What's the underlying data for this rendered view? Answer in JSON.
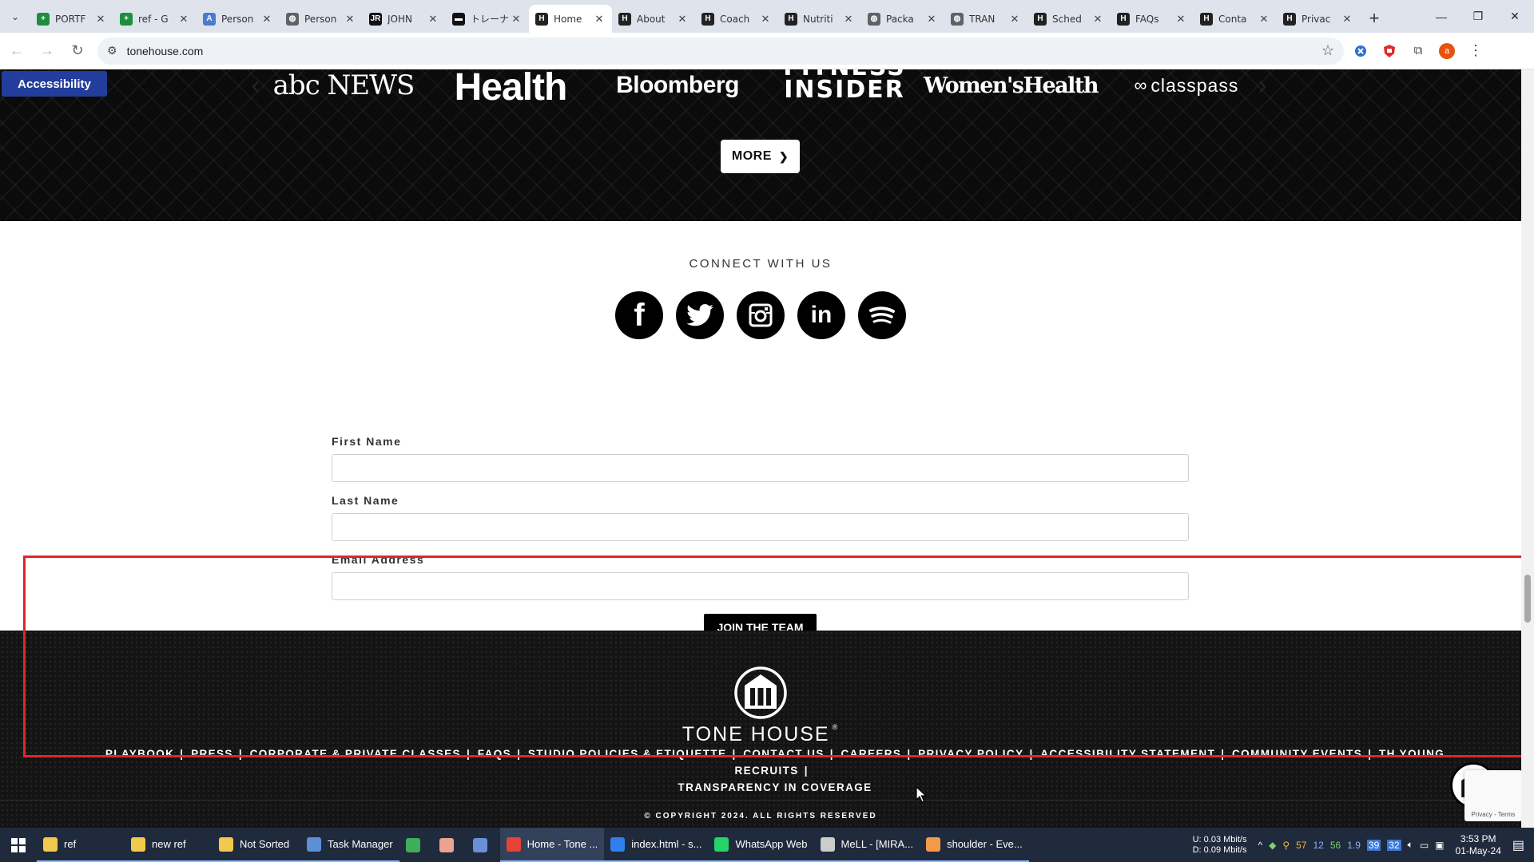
{
  "browser": {
    "tabs": [
      {
        "title": "PORTF",
        "favicon_color": "#1e8e3e",
        "favicon_glyph": "+"
      },
      {
        "title": "ref - G",
        "favicon_color": "#1e8e3e",
        "favicon_glyph": "+"
      },
      {
        "title": "Person",
        "favicon_color": "#4a7bd0",
        "favicon_glyph": "A"
      },
      {
        "title": "Person",
        "favicon_color": "#5f6368",
        "favicon_glyph": "◍"
      },
      {
        "title": "JOHN",
        "favicon_color": "#111111",
        "favicon_glyph": "JR"
      },
      {
        "title": "トレーナ",
        "favicon_color": "#111111",
        "favicon_glyph": "▬"
      },
      {
        "title": "Home",
        "favicon_color": "#222222",
        "favicon_glyph": "H",
        "active": true
      },
      {
        "title": "About",
        "favicon_color": "#222222",
        "favicon_glyph": "H"
      },
      {
        "title": "Coach",
        "favicon_color": "#222222",
        "favicon_glyph": "H"
      },
      {
        "title": "Nutriti",
        "favicon_color": "#222222",
        "favicon_glyph": "H"
      },
      {
        "title": "Packa",
        "favicon_color": "#5f6368",
        "favicon_glyph": "◍"
      },
      {
        "title": "TRAN",
        "favicon_color": "#5f6368",
        "favicon_glyph": "◍"
      },
      {
        "title": "Sched",
        "favicon_color": "#222222",
        "favicon_glyph": "H"
      },
      {
        "title": "FAQs",
        "favicon_color": "#222222",
        "favicon_glyph": "H"
      },
      {
        "title": "Conta",
        "favicon_color": "#222222",
        "favicon_glyph": "H"
      },
      {
        "title": "Privac",
        "favicon_color": "#222222",
        "favicon_glyph": "H"
      }
    ],
    "url": "tonehouse.com",
    "profile_initial": "a"
  },
  "page": {
    "accessibility_label": "Accessibility",
    "press_logos": {
      "abc": "abc NEWS",
      "health": "Health",
      "bloomberg": "Bloomberg",
      "fitness_insider_line1": "FITNESS",
      "fitness_insider_line2": "INSIDER",
      "womens_health": "Women'sHealth",
      "classpass": "classpass"
    },
    "more_label": "MORE",
    "connect": {
      "title": "CONNECT WITH US",
      "social": [
        {
          "name": "facebook",
          "glyph": "f"
        },
        {
          "name": "twitter",
          "glyph": "t"
        },
        {
          "name": "instagram",
          "glyph": "◎"
        },
        {
          "name": "linkedin",
          "glyph": "in"
        },
        {
          "name": "spotify",
          "glyph": "≋"
        }
      ]
    },
    "form": {
      "first_name_label": "First Name",
      "first_name_value": "",
      "last_name_label": "Last Name",
      "last_name_value": "",
      "email_label": "Email Address",
      "email_value": "",
      "submit_label": "JOIN THE TEAM"
    },
    "footer": {
      "brand": "TONE HOUSE",
      "brand_mark": "®",
      "links": [
        "PLAYBOOK",
        "PRESS",
        "CORPORATE & PRIVATE CLASSES",
        "FAQS",
        "STUDIO POLICIES & ETIQUETTE",
        "CONTACT US",
        "CAREERS",
        "PRIVACY POLICY",
        "ACCESSIBILITY STATEMENT",
        "COMMUNITY EVENTS",
        "TH YOUNG RECRUITS",
        "TRANSPARENCY IN COVERAGE"
      ],
      "separator": "|",
      "copyright": "© COPYRIGHT 2024. ALL RIGHTS RESERVED"
    },
    "recaptcha_text": "Privacy - Terms"
  },
  "taskbar": {
    "items": [
      {
        "label": "ref",
        "icon_color": "#f2c94c",
        "state": "running"
      },
      {
        "label": "new ref",
        "icon_color": "#f2c94c",
        "state": "running"
      },
      {
        "label": "Not Sorted",
        "icon_color": "#f2c94c",
        "state": "running"
      },
      {
        "label": "Task Manager",
        "icon_color": "#5c8fd6",
        "state": "running"
      },
      {
        "label": "",
        "icon_color": "#3fae5a",
        "state": "pinned"
      },
      {
        "label": "",
        "icon_color": "#e9a38f",
        "state": "pinned"
      },
      {
        "label": "",
        "icon_color": "#6b8fd6",
        "state": "pinned"
      },
      {
        "label": "Home - Tone ...",
        "icon_color": "#e94235",
        "state": "active"
      },
      {
        "label": "index.html - s...",
        "icon_color": "#2f80ed",
        "state": "running"
      },
      {
        "label": "WhatsApp Web",
        "icon_color": "#25d366",
        "state": "running"
      },
      {
        "label": "MeLL - [MIRA...",
        "icon_color": "#cccccc",
        "state": "running"
      },
      {
        "label": "shoulder - Eve...",
        "icon_color": "#f2994a",
        "state": "running"
      }
    ],
    "net_up": "0.03 Mbit/s",
    "net_down": "0.09 Mbit/s",
    "net_up_label": "U:",
    "net_down_label": "D:",
    "tray_numbers": [
      "57",
      "12",
      "56",
      "1.9",
      "39",
      "32"
    ],
    "time": "3:53 PM",
    "date": "01-May-24"
  }
}
